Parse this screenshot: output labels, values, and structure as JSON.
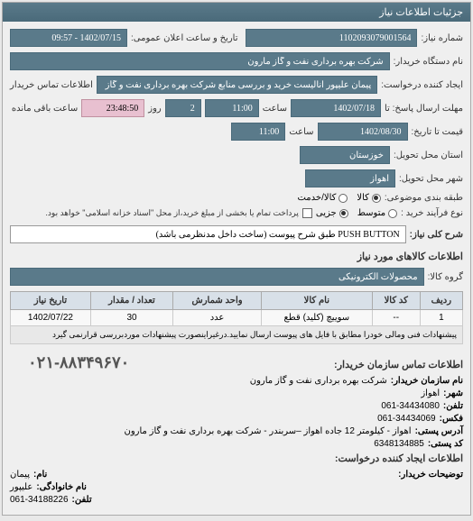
{
  "window": {
    "title": "جزئیات اطلاعات نیاز"
  },
  "fields": {
    "request_number_label": "شماره نیاز:",
    "request_number": "1102093079001564",
    "announce_date_label": "تاریخ و ساعت اعلان عمومی:",
    "announce_date": "1402/07/15 - 09:57",
    "buyer_device_label": "نام دستگاه خریدار:",
    "buyer_device": "شرکت بهره برداری نفت و گاز مارون",
    "requester_label": "ایجاد کننده درخواست:",
    "requester": "پیمان علیپور آنالیست خرید و بررسی منابع شرکت بهره برداری نفت و گاز مارون",
    "contact_label": "اطلاعات تماس خریدار",
    "deadline_send_label": "مهلت ارسال پاسخ: تا",
    "deadline_send_date": "1402/07/18",
    "deadline_send_hour_label": "ساعت",
    "deadline_send_hour": "11:00",
    "deadline_day": "2",
    "deadline_day_label": "روز",
    "deadline_time_left": "23:48:50",
    "deadline_time_left_label": "ساعت باقی مانده",
    "validity_label": "قیمت تا تاریخ:",
    "validity_date": "1402/08/30",
    "validity_hour_label": "ساعت",
    "validity_hour": "11:00",
    "delivery_province_label": "استان محل تحویل:",
    "delivery_province": "خوزستان",
    "delivery_city_label": "شهر محل تحویل:",
    "delivery_city": "اهواز",
    "category_label": "طبقه بندی موضوعی:",
    "partial_label": "نوع فرآیند خرید :",
    "partial_note": "پرداخت تمام یا بخشی از مبلغ خرید،از محل \"اسناد خزانه اسلامی\" خواهد بود.",
    "desc_label": "شرح کلی نیاز:",
    "desc": "PUSH BUTTON طبق شرح پیوست (ساخت داخل مدنظرمی باشد)"
  },
  "radios": {
    "category": {
      "opt1": "کالا",
      "opt2": "کالا/خدمت"
    },
    "partial": {
      "opt1": "متوسط",
      "opt2": "جزیی"
    }
  },
  "items_section": {
    "title": "اطلاعات کالاهای مورد نیاز",
    "group_label": "گروه کالا:",
    "group": "محصولات الکترونیکی"
  },
  "table": {
    "headers": {
      "row": "ردیف",
      "code": "کد کالا",
      "name": "نام کالا",
      "unit": "واحد شمارش",
      "qty": "تعداد / مقدار",
      "date": "تاریخ نیاز"
    },
    "rows": [
      {
        "row": "1",
        "code": "--",
        "name": "سوییچ (کلید) قطع",
        "unit": "عدد",
        "qty": "30",
        "date": "1402/07/22"
      }
    ],
    "note": "پیشنهادات فنی ومالی خودرا مطابق با فایل های پیوست ارسال نمایید.درغیراینصورت پیشنهادات موردبررسی قرارنمی گیرد"
  },
  "contact": {
    "title": "اطلاعات تماس سازمان خریدار:",
    "org_label": "نام سازمان خریدار:",
    "org": "شرکت بهره برداری نفت و گاز مارون",
    "city_label": "شهر:",
    "city": "اهواز",
    "phone_label": "تلفن:",
    "phone": "061-34434080",
    "fax_label": "فکس:",
    "fax": "061-34434069",
    "addr_label": "آدرس پستی:",
    "addr": "اهواز - کیلومتر 12 جاده اهواز –سربندر - شرکت بهره برداری نفت و گاز مارون",
    "postal_label": "کد پستی:",
    "postal": "6348134885",
    "requester_info_title": "اطلاعات ایجاد کننده درخواست:",
    "name_label": "نام:",
    "name": "پیمان",
    "family_label": "نام خانوادگی:",
    "family": "علیپور",
    "buyer_notes_label": "توضیحات خریدار:",
    "req_phone_label": "تلفن:",
    "req_phone": "061-34188226",
    "big_phone": "۰۲۱-۸۸۳۴۹۶۷۰"
  }
}
